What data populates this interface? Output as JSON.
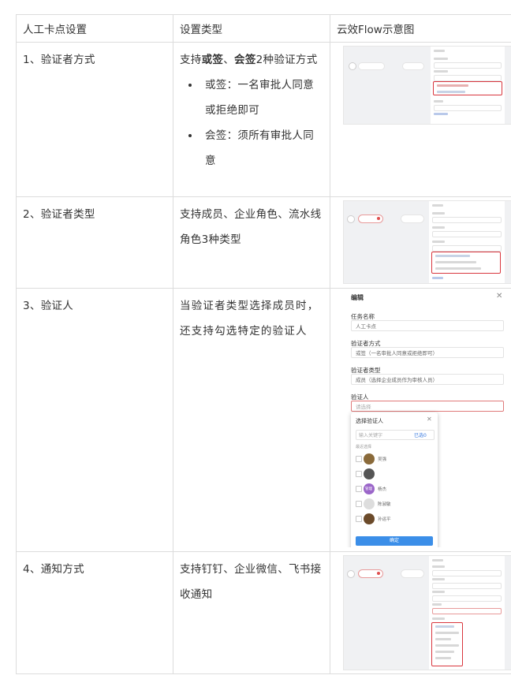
{
  "headers": [
    "人工卡点设置",
    "设置类型",
    "云效Flow示意图"
  ],
  "rows": [
    {
      "name": "1、验证者方式",
      "desc_pre": "支持",
      "desc_bold1": "或签",
      "desc_mid": "、",
      "desc_bold2": "会签",
      "desc_post": "2种验证方式",
      "bullets": [
        "或签：一名审批人同意或拒绝即可",
        "会签：须所有审批人同意"
      ]
    },
    {
      "name": "2、验证者类型",
      "desc": "支持成员、企业角色、流水线角色3种类型"
    },
    {
      "name": "3、验证人",
      "desc": "当验证者类型选择成员时，还支持勾选特定的验证人"
    },
    {
      "name": "4、通知方式",
      "desc": "支持钉钉、企业微信、飞书接收通知"
    }
  ],
  "shot3": {
    "title": "编辑",
    "task_label": "任务名称",
    "task_value": "人工卡点",
    "mode_label": "验证者方式",
    "mode_value": "或签（一名审批人同意或拒绝即可）",
    "type_label": "验证者类型",
    "type_value": "成员（选择企业成员作为审核人员）",
    "verifier_label": "验证人",
    "verifier_placeholder": "请选择",
    "popup_title": "选择验证人",
    "popup_search": "输入关键字",
    "popup_selected": "已选0",
    "popup_recent": "最近选择",
    "popup_users": [
      "吴强",
      "",
      "杨杰",
      "陈淑敏",
      "孙运平"
    ],
    "popup_avatar_text": "管理",
    "confirm": "确定"
  }
}
